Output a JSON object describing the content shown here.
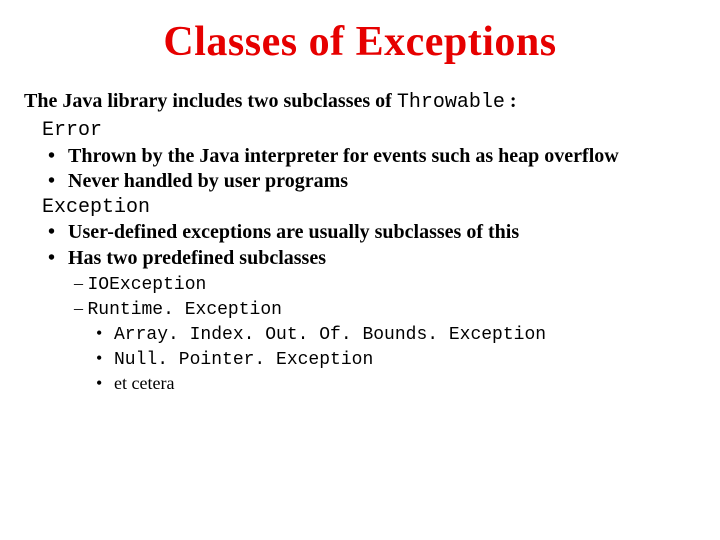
{
  "title": "Classes of Exceptions",
  "intro_pre": "The Java library includes two subclasses of ",
  "intro_code": "Throwable",
  "intro_post": " :",
  "error_hdr": "Error",
  "error_b1": "Thrown by the Java interpreter for events such as heap overflow",
  "error_b2": "Never handled by user programs",
  "exc_hdr": "Exception",
  "exc_b1": "User-defined exceptions are usually subclasses of this",
  "exc_b2": "Has two predefined subclasses",
  "dash1_code": "IOException",
  "dash2_code": "Runtime. Exception",
  "sub1": "Array. Index. Out. Of. Bounds. Exception",
  "sub2": "Null. Pointer. Exception",
  "sub3": "et cetera",
  "dash": "– "
}
